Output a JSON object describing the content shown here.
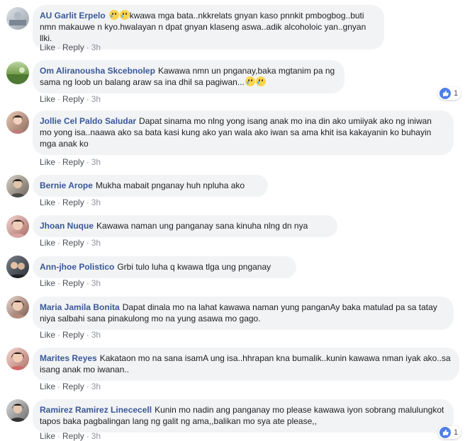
{
  "actions": {
    "like": "Like",
    "reply": "Reply",
    "dot": "·",
    "time": "3h"
  },
  "comments": [
    {
      "author": "AU Garlit Erpelo",
      "text": "kwawa mga bata..nkkrelats gnyan kaso pnnkit pmbogbog..buti nmn makauwe n kyo.hwalayan n dpat gnyan klaseng aswa..adik alcoholoic yan..gnyan llki.",
      "emojis": 2
    },
    {
      "author": "Om Aliranousha Skcebnolep",
      "text": "Kawawa nmn un pnganay,baka mgtanim pa ng sama ng loob un balang araw sa ina dhil sa pagiwan...",
      "emojis": 2,
      "reactions": "1"
    },
    {
      "author": "Jollie Cel Paldo Saludar",
      "text": "Dapat sinama mo nlng yong isang anak mo ina din ako umiiyak ako ng iniwan mo yong isa..naawa ako sa bata kasi kung ako yan wala ako iwan sa ama khit isa kakayanin ko buhayin mga anak ko"
    },
    {
      "author": "Bernie Arope",
      "text": "Mukha mabait pnganay huh npluha ako"
    },
    {
      "author": "Jhoan Nuque",
      "text": "Kawawa naman ung panganay sana kinuha nlng dn nya"
    },
    {
      "author": "Ann-jhoe Polistico",
      "text": "Grbi tulo luha q kwawa tlga ung pnganay"
    },
    {
      "author": "Maria Jamila Bonita",
      "text": "Dapat dinala mo na lahat kawawa naman yung panganAy baka matulad pa sa tatay niya salbahi sana pinakulong mo na yung asawa mo gago."
    },
    {
      "author": "Marites Reyes",
      "text": "Kakataon mo na sana isamA ung isa..hhrapan kna bumalik..kunin kawawa nman iyak ako..sa isang anak mo iwanan.."
    },
    {
      "author": "Ramirez Ramirez Linececell",
      "text": "Kunin mo nadin ang panganay mo please kawawa iyon sobrang malulungkot tapos baka pagbalingan lang ng galit ng ama,,balikan mo sya ate please,,",
      "reactions": "1"
    }
  ]
}
